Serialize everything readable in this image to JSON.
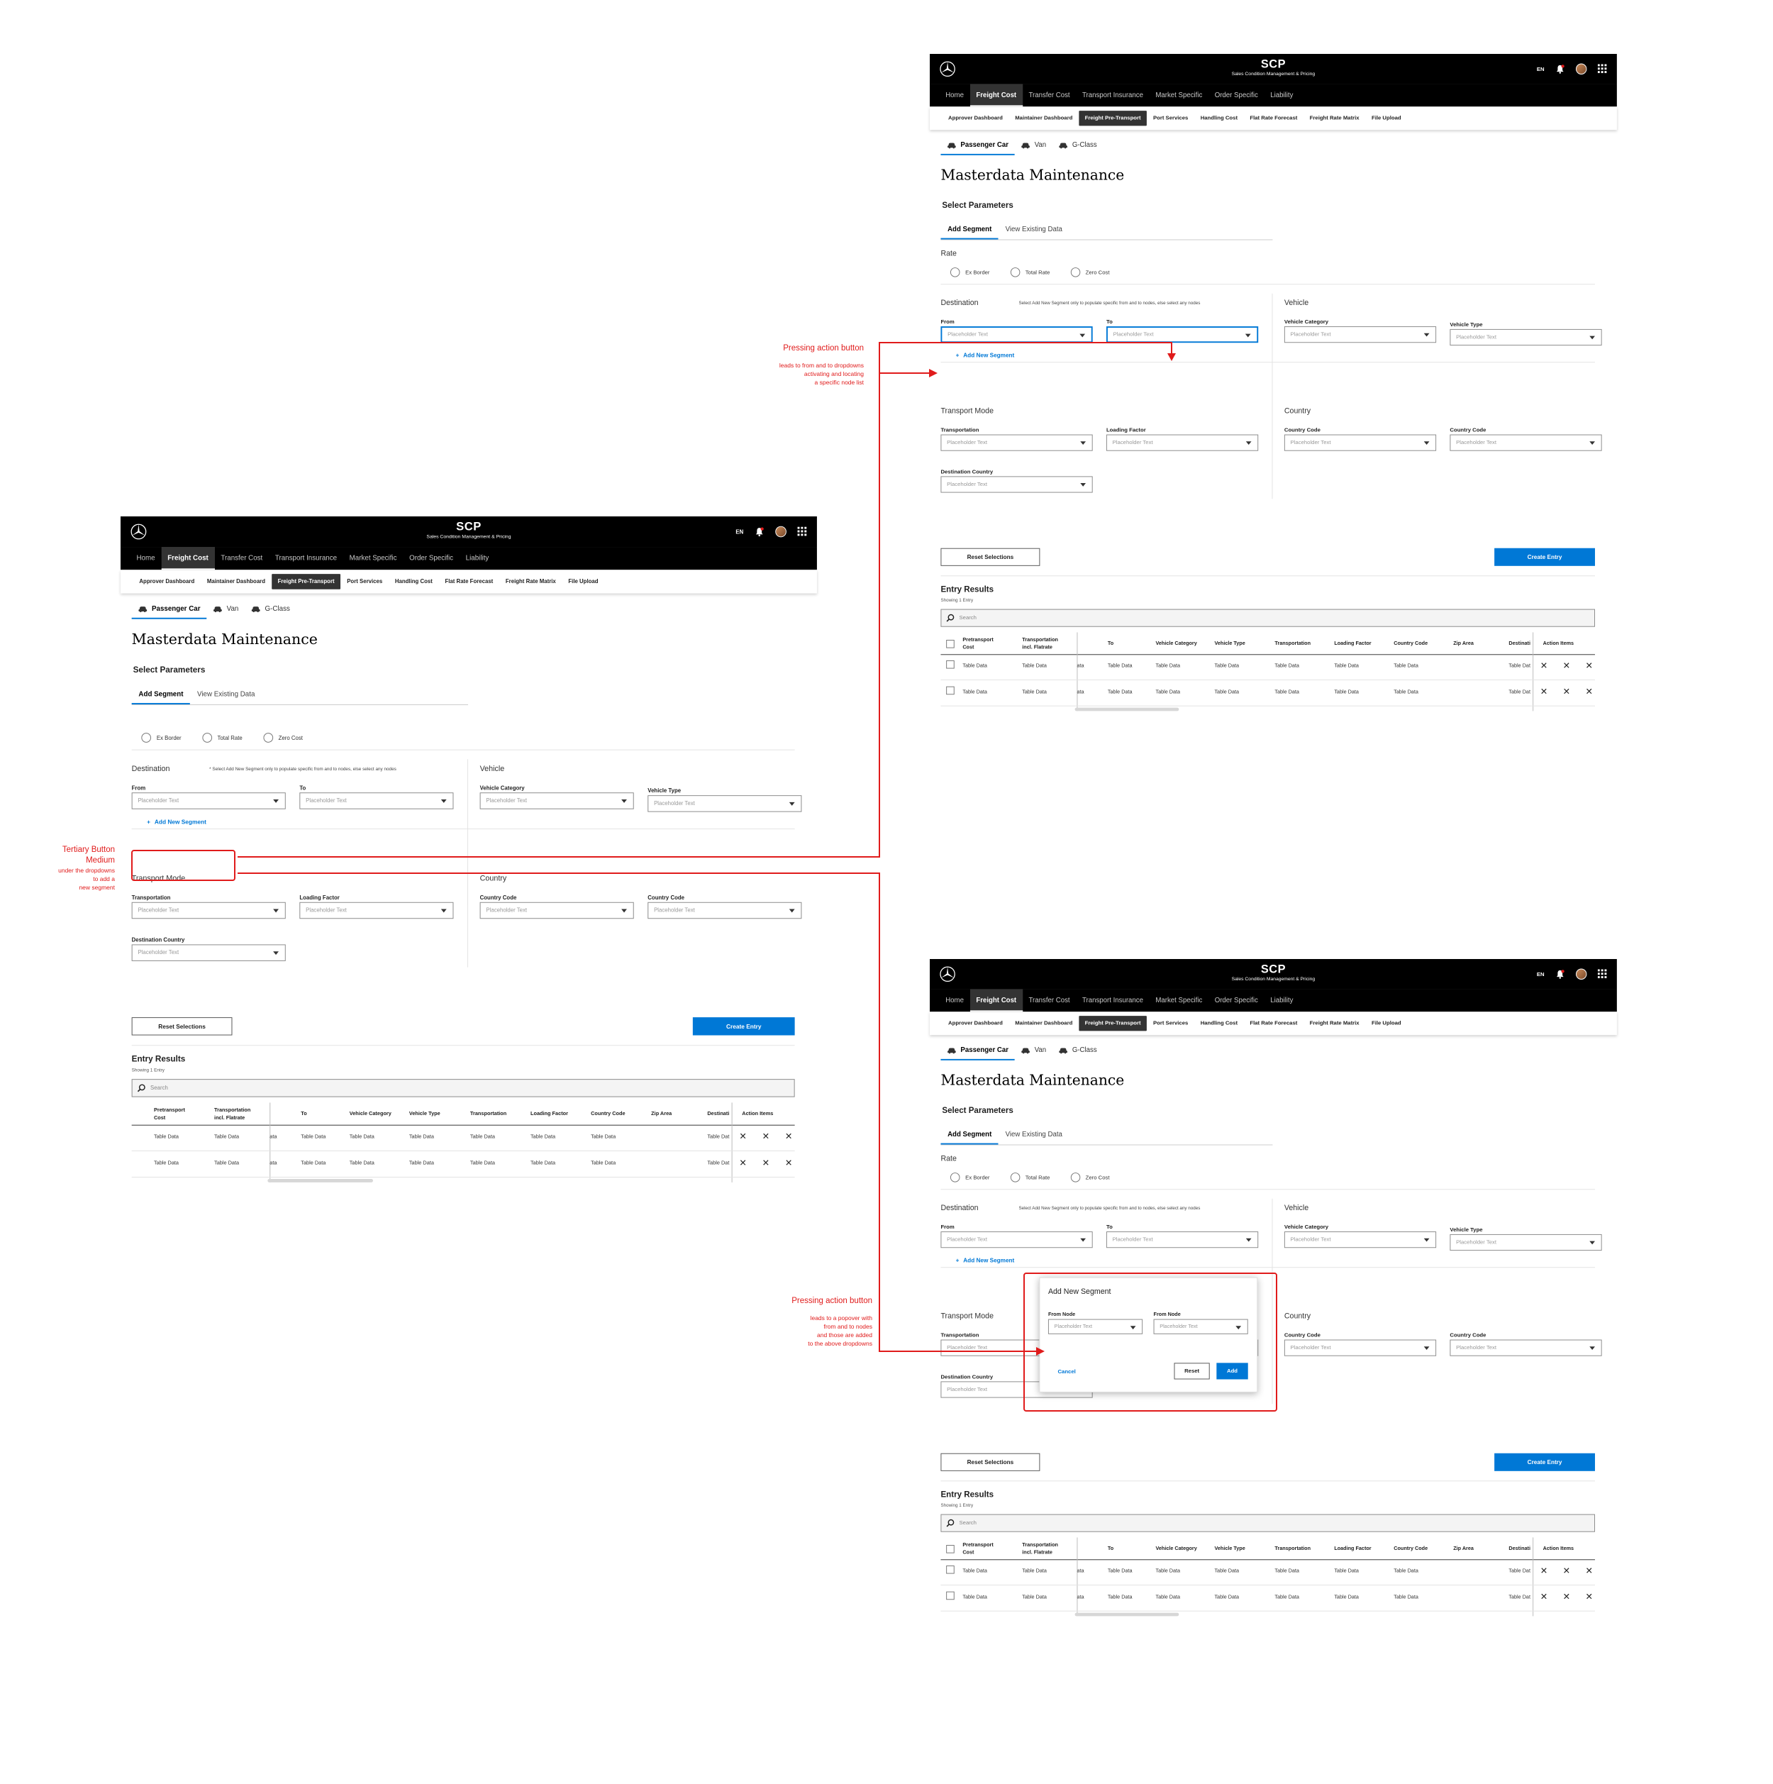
{
  "brand": {
    "title": "SCP",
    "subtitle": "Sales Condition Management & Pricing"
  },
  "header": {
    "language": "EN"
  },
  "main_nav": [
    "Home",
    "Freight Cost",
    "Transfer Cost",
    "Transport Insurance",
    "Market Specific",
    "Order Specific",
    "Liability"
  ],
  "main_nav_active": 1,
  "sub_nav": [
    "Approver Dashboard",
    "Maintainer Dashboard",
    "Freight Pre-Transport",
    "Port Services",
    "Handling Cost",
    "Flat Rate Forecast",
    "Freight Rate Matrix",
    "File Upload"
  ],
  "sub_nav_active": 2,
  "vehicle_tabs": [
    "Passenger Car",
    "Van",
    "G-Class"
  ],
  "page_title": "Masterdata Maintenance",
  "section_title": "Select Parameters",
  "form_tabs": [
    "Add Segment",
    "View Existing Data"
  ],
  "rate": {
    "label": "Rate",
    "options": [
      "Ex Border",
      "Total Rate",
      "Zero Cost"
    ]
  },
  "destination": {
    "title": "Destination",
    "hint": "Select Add New Segment only to populate specific from and to nodes, else select any nodes",
    "hint_first": "* Select Add New Segment only to populate specific from and to nodes, else select any nodes",
    "from_label": "From",
    "to_label": "To"
  },
  "vehicle": {
    "title": "Vehicle",
    "category_label": "Vehicle Category",
    "type_label": "Vehicle Type"
  },
  "transport_mode": {
    "title": "Transport Mode",
    "transportation_label": "Transportation",
    "loading_factor_label": "Loading Factor",
    "destination_country_label": "Destination Country"
  },
  "country": {
    "title": "Country",
    "code_label": "Country Code"
  },
  "placeholder": "Placeholder Text",
  "add_segment_label": "Add New Segment",
  "buttons": {
    "reset": "Reset Selections",
    "create": "Create Entry"
  },
  "results": {
    "title": "Entry Results",
    "subtitle": "Showing 1 Entry",
    "search_placeholder": "Search",
    "columns": [
      "Pretransport\nCost",
      "Transportation\nincl. Flatrate",
      "To",
      "Vehicle Category",
      "Vehicle Type",
      "Transportation",
      "Loading Factor",
      "Country Code",
      "Zip Area",
      "Destinati",
      "Action Items"
    ],
    "cell": "Table Data",
    "cell_clipped_left": "ata",
    "cell_clipped_right": "Table Dat",
    "row_count": 2
  },
  "popover": {
    "title": "Add New Segment",
    "from_node_label": "From Node",
    "second_node_label": "From Node",
    "cancel": "Cancel",
    "reset": "Reset",
    "add": "Add"
  },
  "annotations": {
    "tertiary": {
      "title": "Tertiary Button",
      "title2": "Medium",
      "lines": [
        "under the dropdowns",
        "to add a",
        "new segment"
      ]
    },
    "dropdowns": {
      "title": "Pressing action button",
      "lines": [
        "leads to  from and to dropdowns",
        "activating and locating",
        "a specific node list"
      ]
    },
    "popover": {
      "title": "Pressing action button",
      "lines": [
        "leads to  a popover with",
        "from and to nodes",
        "and those are added",
        "to the above dropdowns"
      ]
    }
  },
  "colors": {
    "accent": "#0078d6",
    "annotation": "#e01b1b",
    "header": "#000000"
  }
}
